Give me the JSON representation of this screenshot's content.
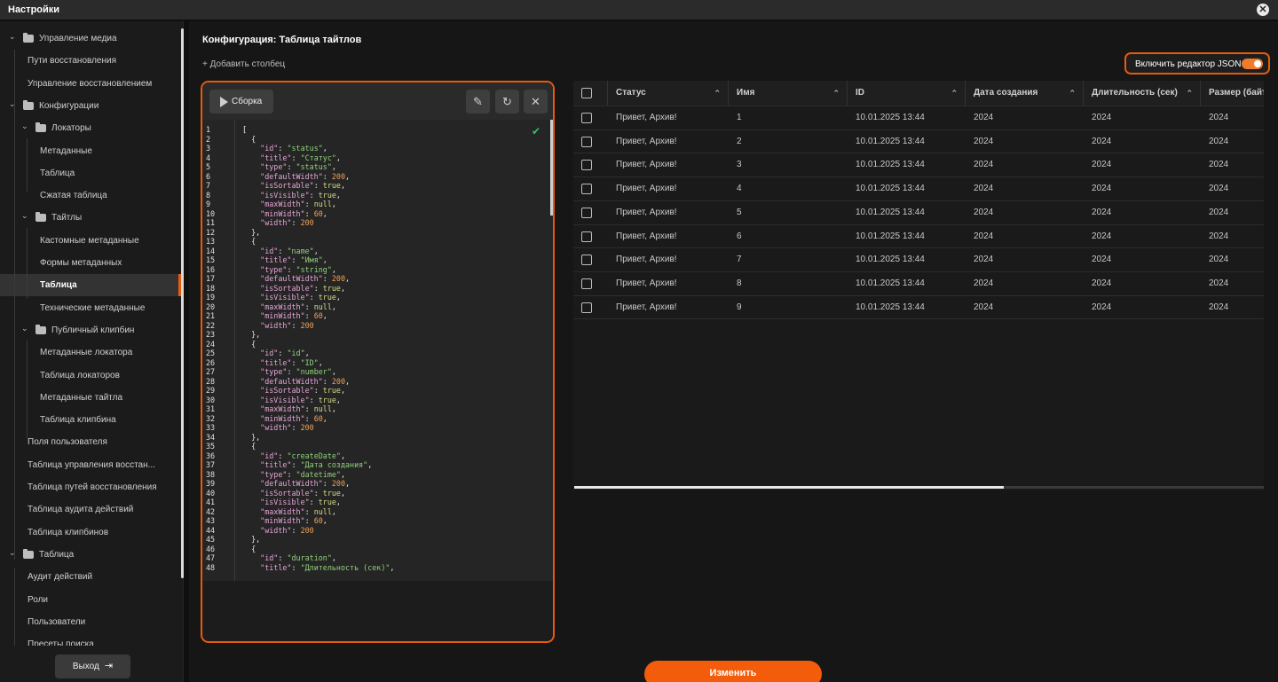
{
  "window": {
    "title": "Настройки"
  },
  "sidebar": {
    "items": [
      {
        "label": "Управление медиа",
        "type": "folder",
        "level": 0
      },
      {
        "label": "Пути восстановления",
        "type": "leaf",
        "level": 1
      },
      {
        "label": "Управление восстановлением",
        "type": "leaf",
        "level": 1
      },
      {
        "label": "Конфигурации",
        "type": "folder",
        "level": 0
      },
      {
        "label": "Локаторы",
        "type": "folder",
        "level": 1
      },
      {
        "label": "Метаданные",
        "type": "leaf",
        "level": 2
      },
      {
        "label": "Таблица",
        "type": "leaf",
        "level": 2
      },
      {
        "label": "Сжатая таблица",
        "type": "leaf",
        "level": 2
      },
      {
        "label": "Тайтлы",
        "type": "folder",
        "level": 1
      },
      {
        "label": "Кастомные метаданные",
        "type": "leaf",
        "level": 2
      },
      {
        "label": "Формы метаданных",
        "type": "leaf",
        "level": 2
      },
      {
        "label": "Таблица",
        "type": "leaf",
        "level": 2,
        "selected": true
      },
      {
        "label": "Технические метаданные",
        "type": "leaf",
        "level": 2
      },
      {
        "label": "Публичный клипбин",
        "type": "folder",
        "level": 1
      },
      {
        "label": "Метаданные локатора",
        "type": "leaf",
        "level": 2
      },
      {
        "label": "Таблица локаторов",
        "type": "leaf",
        "level": 2
      },
      {
        "label": "Метаданные тайтла",
        "type": "leaf",
        "level": 2
      },
      {
        "label": "Таблица клипбина",
        "type": "leaf",
        "level": 2
      },
      {
        "label": "Поля пользователя",
        "type": "leaf",
        "level": 1
      },
      {
        "label": "Таблица управления восстан...",
        "type": "leaf",
        "level": 1
      },
      {
        "label": "Таблица путей восстановления",
        "type": "leaf",
        "level": 1
      },
      {
        "label": "Таблица аудита действий",
        "type": "leaf",
        "level": 1
      },
      {
        "label": "Таблица клипбинов",
        "type": "leaf",
        "level": 1
      },
      {
        "label": "Таблица",
        "type": "folder",
        "level": 0
      },
      {
        "label": "Аудит действий",
        "type": "leaf",
        "level": 1
      },
      {
        "label": "Роли",
        "type": "leaf",
        "level": 1
      },
      {
        "label": "Пользователи",
        "type": "leaf",
        "level": 1
      },
      {
        "label": "Пресеты поиска",
        "type": "leaf",
        "level": 1
      }
    ],
    "logout_label": "Выход",
    "logout_icon": "logout-icon"
  },
  "main": {
    "title": "Конфигурация: Таблица тайтлов",
    "add_column": "+ Добавить столбец",
    "json_toggle_label": "Включить редактор JSON",
    "json_toggle_on": true,
    "accent_color": "#e85a0c",
    "submit_label": "Изменить"
  },
  "editor": {
    "build_label": "Сборка",
    "tools": [
      "edit-icon",
      "reset-icon",
      "close-icon"
    ],
    "lines": [
      "[",
      "  {",
      "    \"id\": \"status\",",
      "    \"title\": \"Статус\",",
      "    \"type\": \"status\",",
      "    \"defaultWidth\": 200,",
      "    \"isSortable\": true,",
      "    \"isVisible\": true,",
      "    \"maxWidth\": null,",
      "    \"minWidth\": 60,",
      "    \"width\": 200",
      "  },",
      "  {",
      "    \"id\": \"name\",",
      "    \"title\": \"Имя\",",
      "    \"type\": \"string\",",
      "    \"defaultWidth\": 200,",
      "    \"isSortable\": true,",
      "    \"isVisible\": true,",
      "    \"maxWidth\": null,",
      "    \"minWidth\": 60,",
      "    \"width\": 200",
      "  },",
      "  {",
      "    \"id\": \"id\",",
      "    \"title\": \"ID\",",
      "    \"type\": \"number\",",
      "    \"defaultWidth\": 200,",
      "    \"isSortable\": true,",
      "    \"isVisible\": true,",
      "    \"maxWidth\": null,",
      "    \"minWidth\": 60,",
      "    \"width\": 200",
      "  },",
      "  {",
      "    \"id\": \"createDate\",",
      "    \"title\": \"Дата создания\",",
      "    \"type\": \"datetime\",",
      "    \"defaultWidth\": 200,",
      "    \"isSortable\": true,",
      "    \"isVisible\": true,",
      "    \"maxWidth\": null,",
      "    \"minWidth\": 60,",
      "    \"width\": 200",
      "  },",
      "  {",
      "    \"id\": \"duration\",",
      "    \"title\": \"Длительность (сек)\","
    ]
  },
  "table": {
    "columns": [
      "Статус",
      "Имя",
      "ID",
      "Дата создания",
      "Длительность (сек)",
      "Размер (байт"
    ],
    "rows": [
      [
        "Привет, Архив!",
        "1",
        "10.01.2025 13:44",
        "2024",
        "2024",
        "2024"
      ],
      [
        "Привет, Архив!",
        "2",
        "10.01.2025 13:44",
        "2024",
        "2024",
        "2024"
      ],
      [
        "Привет, Архив!",
        "3",
        "10.01.2025 13:44",
        "2024",
        "2024",
        "2024"
      ],
      [
        "Привет, Архив!",
        "4",
        "10.01.2025 13:44",
        "2024",
        "2024",
        "2024"
      ],
      [
        "Привет, Архив!",
        "5",
        "10.01.2025 13:44",
        "2024",
        "2024",
        "2024"
      ],
      [
        "Привет, Архив!",
        "6",
        "10.01.2025 13:44",
        "2024",
        "2024",
        "2024"
      ],
      [
        "Привет, Архив!",
        "7",
        "10.01.2025 13:44",
        "2024",
        "2024",
        "2024"
      ],
      [
        "Привет, Архив!",
        "8",
        "10.01.2025 13:44",
        "2024",
        "2024",
        "2024"
      ],
      [
        "Привет, Архив!",
        "9",
        "10.01.2025 13:44",
        "2024",
        "2024",
        "2024"
      ]
    ]
  }
}
